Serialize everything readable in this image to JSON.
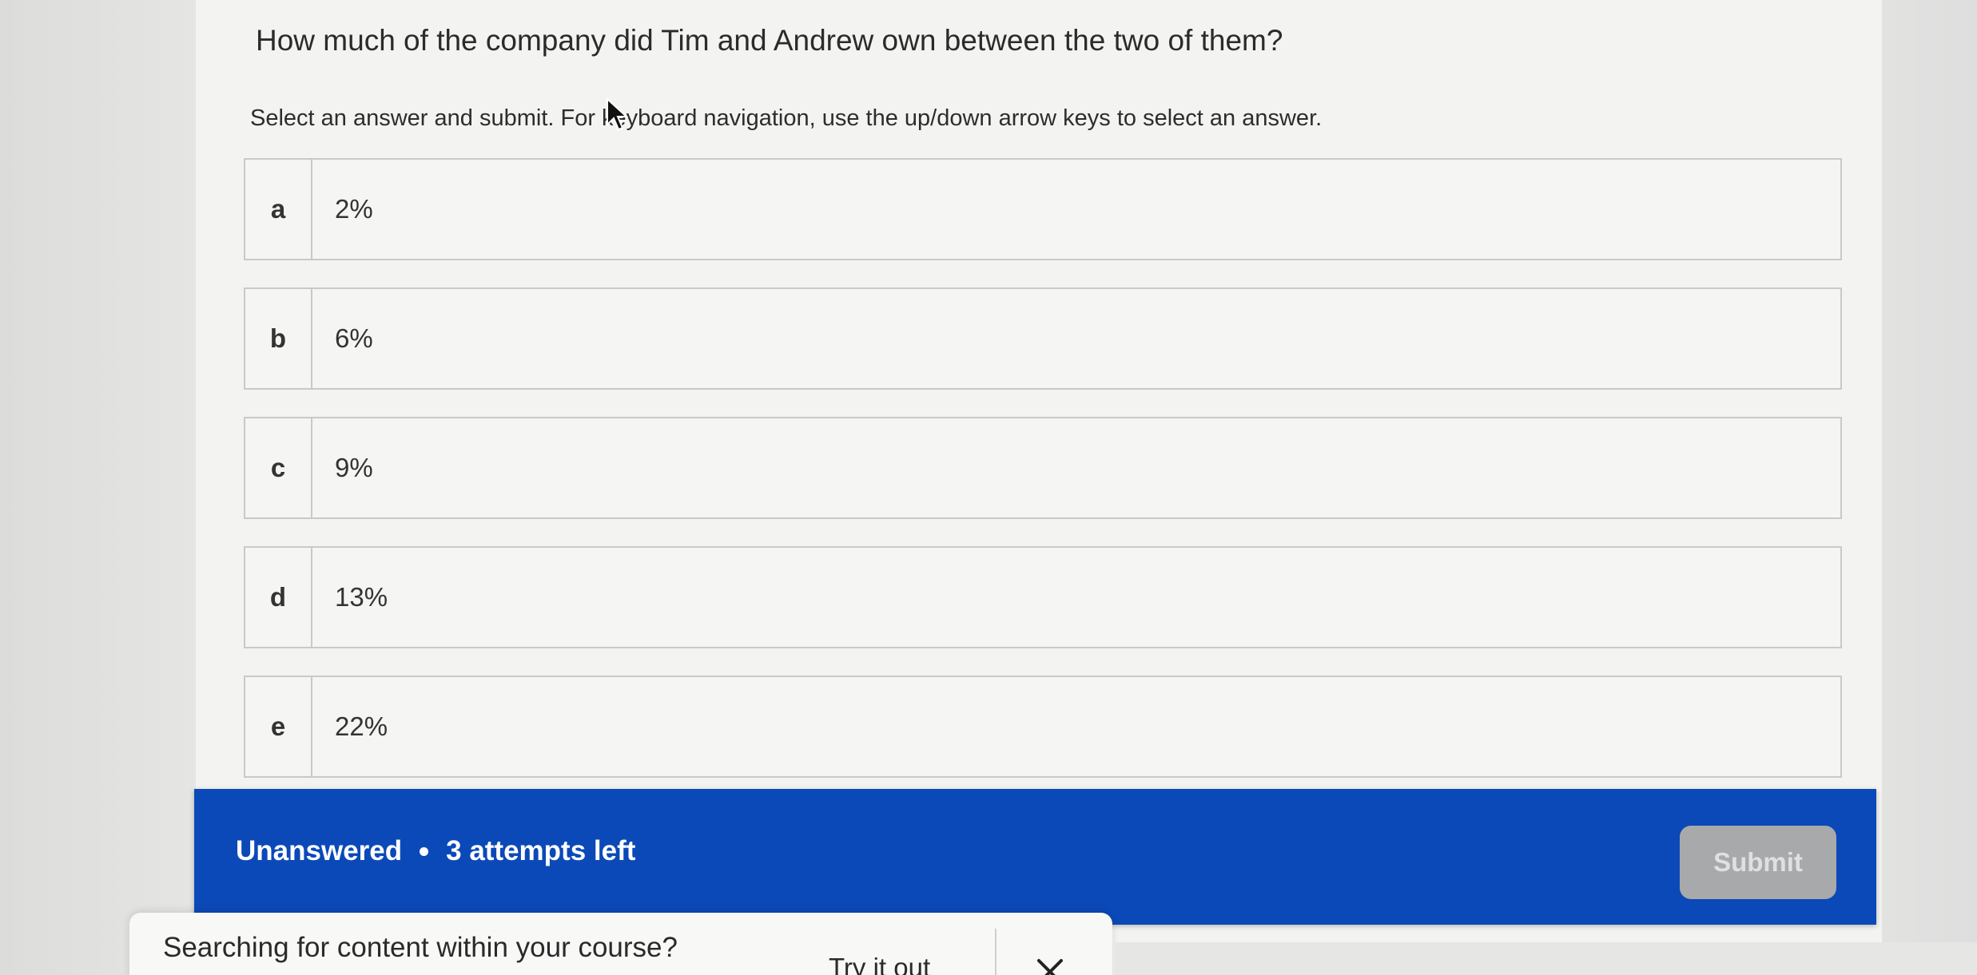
{
  "question": {
    "text": "How much of the company did Tim and Andrew own between the two of them?"
  },
  "instructions": {
    "text": "Select an answer and submit. For keyboard navigation, use the up/down arrow keys to select an answer."
  },
  "answers": [
    {
      "letter": "a",
      "value": "2%"
    },
    {
      "letter": "b",
      "value": "6%"
    },
    {
      "letter": "c",
      "value": "9%"
    },
    {
      "letter": "d",
      "value": "13%"
    },
    {
      "letter": "e",
      "value": "22%"
    }
  ],
  "status": {
    "state": "Unanswered",
    "attempts": "3 attempts left",
    "background_color": "#0c49b8"
  },
  "submit": {
    "label": "Submit",
    "enabled": false
  },
  "search_popup": {
    "text": "Searching for content within your course?",
    "link_label": "Try it out",
    "close_icon": "close-icon"
  }
}
